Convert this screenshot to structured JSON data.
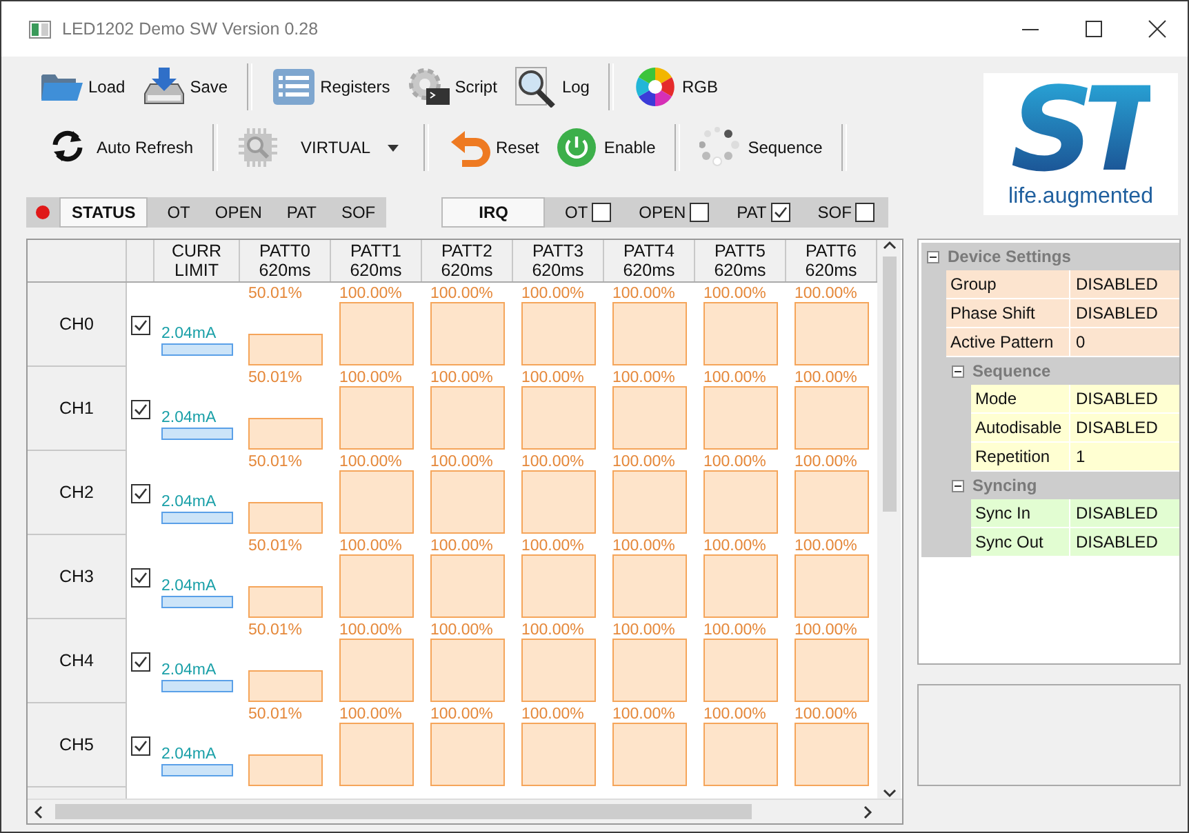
{
  "window": {
    "title": "LED1202 Demo SW Version 0.28"
  },
  "toolbar_rows": [
    [
      {
        "kind": "button",
        "label": "Load"
      },
      {
        "kind": "button",
        "label": "Save"
      },
      {
        "kind": "separator"
      },
      {
        "kind": "button",
        "label": "Registers"
      },
      {
        "kind": "button",
        "label": "Script"
      },
      {
        "kind": "button",
        "label": "Log"
      },
      {
        "kind": "separator"
      },
      {
        "kind": "button",
        "label": "RGB"
      }
    ],
    [
      {
        "kind": "button",
        "label": "Auto Refresh"
      },
      {
        "kind": "separator"
      },
      {
        "kind": "icon_button",
        "disabled": true
      },
      {
        "kind": "dropdown",
        "value": "VIRTUAL"
      },
      {
        "kind": "separator"
      },
      {
        "kind": "button",
        "label": "Reset"
      },
      {
        "kind": "button",
        "label": "Enable"
      },
      {
        "kind": "separator"
      },
      {
        "kind": "button",
        "label": "Sequence"
      },
      {
        "kind": "separator"
      }
    ]
  ],
  "logo": {
    "mark": "ST",
    "tagline": "life.augmented"
  },
  "status_panel": {
    "led_on": true,
    "label": "STATUS",
    "flags": [
      "OT",
      "OPEN",
      "PAT",
      "SOF"
    ]
  },
  "irq_panel": {
    "label": "IRQ",
    "flags": [
      {
        "label": "OT",
        "checked": false
      },
      {
        "label": "OPEN",
        "checked": false
      },
      {
        "label": "PAT",
        "checked": true
      },
      {
        "label": "SOF",
        "checked": false
      }
    ]
  },
  "grid": {
    "columns": [
      {
        "title": "CURR",
        "subtitle": "LIMIT"
      },
      {
        "title": "PATT0",
        "subtitle": "620ms"
      },
      {
        "title": "PATT1",
        "subtitle": "620ms"
      },
      {
        "title": "PATT2",
        "subtitle": "620ms"
      },
      {
        "title": "PATT3",
        "subtitle": "620ms"
      },
      {
        "title": "PATT4",
        "subtitle": "620ms"
      },
      {
        "title": "PATT5",
        "subtitle": "620ms"
      },
      {
        "title": "PATT6",
        "subtitle": "620ms"
      }
    ],
    "rows": [
      {
        "name": "CH0",
        "enabled": true,
        "current": "2.04mA",
        "patterns": [
          {
            "value": "50.01%"
          },
          {
            "value": "100.00%"
          },
          {
            "value": "100.00%"
          },
          {
            "value": "100.00%"
          },
          {
            "value": "100.00%"
          },
          {
            "value": "100.00%"
          },
          {
            "value": "100.00%"
          }
        ]
      },
      {
        "name": "CH1",
        "enabled": true,
        "current": "2.04mA",
        "patterns": [
          {
            "value": "50.01%"
          },
          {
            "value": "100.00%"
          },
          {
            "value": "100.00%"
          },
          {
            "value": "100.00%"
          },
          {
            "value": "100.00%"
          },
          {
            "value": "100.00%"
          },
          {
            "value": "100.00%"
          }
        ]
      },
      {
        "name": "CH2",
        "enabled": true,
        "current": "2.04mA",
        "patterns": [
          {
            "value": "50.01%"
          },
          {
            "value": "100.00%"
          },
          {
            "value": "100.00%"
          },
          {
            "value": "100.00%"
          },
          {
            "value": "100.00%"
          },
          {
            "value": "100.00%"
          },
          {
            "value": "100.00%"
          }
        ]
      },
      {
        "name": "CH3",
        "enabled": true,
        "current": "2.04mA",
        "patterns": [
          {
            "value": "50.01%"
          },
          {
            "value": "100.00%"
          },
          {
            "value": "100.00%"
          },
          {
            "value": "100.00%"
          },
          {
            "value": "100.00%"
          },
          {
            "value": "100.00%"
          },
          {
            "value": "100.00%"
          }
        ]
      },
      {
        "name": "CH4",
        "enabled": true,
        "current": "2.04mA",
        "patterns": [
          {
            "value": "50.01%"
          },
          {
            "value": "100.00%"
          },
          {
            "value": "100.00%"
          },
          {
            "value": "100.00%"
          },
          {
            "value": "100.00%"
          },
          {
            "value": "100.00%"
          },
          {
            "value": "100.00%"
          }
        ]
      },
      {
        "name": "CH5",
        "enabled": true,
        "current": "2.04mA",
        "patterns": [
          {
            "value": "50.01%"
          },
          {
            "value": "100.00%"
          },
          {
            "value": "100.00%"
          },
          {
            "value": "100.00%"
          },
          {
            "value": "100.00%"
          },
          {
            "value": "100.00%"
          },
          {
            "value": "100.00%"
          }
        ]
      }
    ]
  },
  "device_settings": {
    "title": "Device Settings",
    "expanded": true,
    "color": "#fce4cf",
    "properties": [
      {
        "name": "Group",
        "value": "DISABLED"
      },
      {
        "name": "Phase Shift",
        "value": "DISABLED"
      },
      {
        "name": "Active Pattern",
        "value": "0"
      }
    ],
    "children": [
      {
        "title": "Sequence",
        "expanded": true,
        "color": "#ffffd2",
        "properties": [
          {
            "name": "Mode",
            "value": "DISABLED"
          },
          {
            "name": "Autodisable",
            "value": "DISABLED"
          },
          {
            "name": "Repetition",
            "value": "1"
          }
        ]
      },
      {
        "title": "Syncing",
        "expanded": true,
        "color": "#e2fdd2",
        "properties": [
          {
            "name": "Sync In",
            "value": "DISABLED"
          },
          {
            "name": "Sync Out",
            "value": "DISABLED"
          }
        ]
      }
    ]
  }
}
